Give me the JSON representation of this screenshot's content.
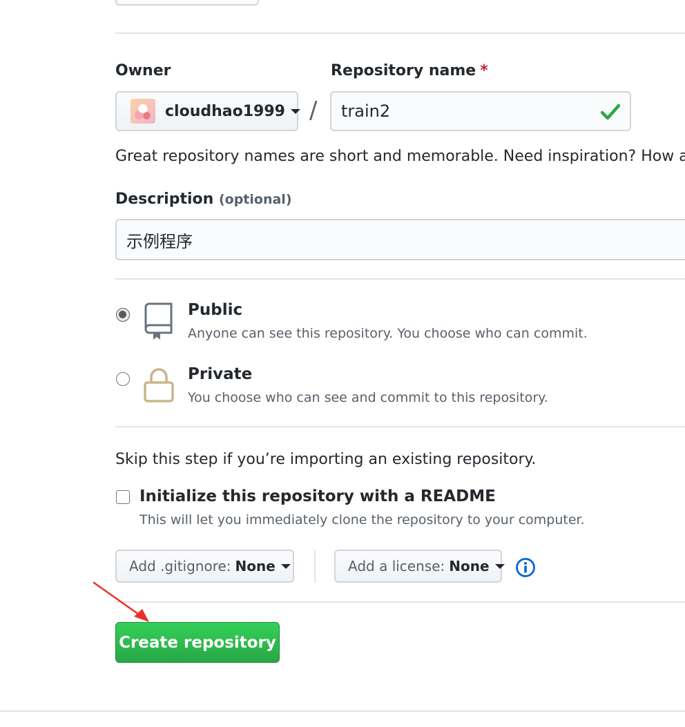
{
  "owner": {
    "label": "Owner",
    "username": "cloudhao1999"
  },
  "separator": "/",
  "repo_name": {
    "label": "Repository name",
    "required_mark": "*",
    "value": "train2"
  },
  "name_hint": "Great repository names are short and memorable. Need inspiration? How ab",
  "description": {
    "label": "Description",
    "optional": "(optional)",
    "value": "示例程序"
  },
  "visibility": {
    "public": {
      "title": "Public",
      "subtitle": "Anyone can see this repository. You choose who can commit.",
      "checked": true
    },
    "private": {
      "title": "Private",
      "subtitle": "You choose who can see and commit to this repository.",
      "checked": false
    }
  },
  "import_note": "Skip this step if you’re importing an existing repository.",
  "readme": {
    "title": "Initialize this repository with a README",
    "subtitle": "This will let you immediately clone the repository to your computer.",
    "checked": false
  },
  "gitignore": {
    "label": "Add .gitignore:",
    "value": "None"
  },
  "license": {
    "label": "Add a license:",
    "value": "None"
  },
  "create_button": "Create repository",
  "colors": {
    "success_green": "#28a745",
    "info_blue": "#0366d6",
    "required_red": "#cb2431",
    "arrow_red": "#e8302a"
  }
}
